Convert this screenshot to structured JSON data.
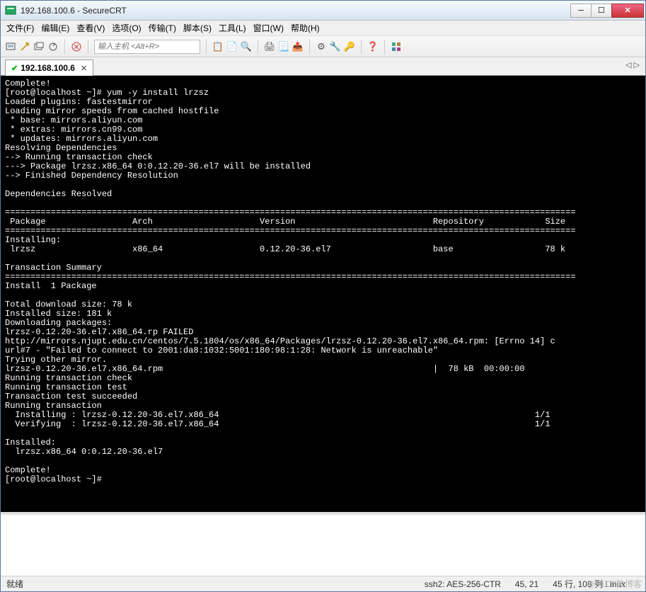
{
  "window": {
    "title": "192.168.100.6 - SecureCRT"
  },
  "menu": {
    "file": "文件(F)",
    "edit": "编辑(E)",
    "view": "查看(V)",
    "options": "选项(O)",
    "transfer": "传输(T)",
    "script": "脚本(S)",
    "tools": "工具(L)",
    "window": "窗口(W)",
    "help": "帮助(H)"
  },
  "toolbar": {
    "host_placeholder": "输入主机 <Alt+R>"
  },
  "tab": {
    "label": "192.168.100.6",
    "close": "✕"
  },
  "terminal": {
    "text": "Complete!\n[root@localhost ~]# yum -y install lrzsz\nLoaded plugins: fastestmirror\nLoading mirror speeds from cached hostfile\n * base: mirrors.aliyun.com\n * extras: mirrors.cn99.com\n * updates: mirrors.aliyun.com\nResolving Dependencies\n--> Running transaction check\n---> Package lrzsz.x86_64 0:0.12.20-36.el7 will be installed\n--> Finished Dependency Resolution\n\nDependencies Resolved\n\n================================================================================================================\n Package                 Arch                     Version                           Repository            Size\n================================================================================================================\nInstalling:\n lrzsz                   x86_64                   0.12.20-36.el7                    base                  78 k\n\nTransaction Summary\n================================================================================================================\nInstall  1 Package\n\nTotal download size: 78 k\nInstalled size: 181 k\nDownloading packages:\nlrzsz-0.12.20-36.el7.x86_64.rp FAILED\nhttp://mirrors.njupt.edu.cn/centos/7.5.1804/os/x86_64/Packages/lrzsz-0.12.20-36.el7.x86_64.rpm: [Errno 14] c\nurl#7 - \"Failed to connect to 2001:da8:1032:5001:180:98:1:28: Network is unreachable\"\nTrying other mirror.\nlrzsz-0.12.20-36.el7.x86_64.rpm                                                     |  78 kB  00:00:00\nRunning transaction check\nRunning transaction test\nTransaction test succeeded\nRunning transaction\n  Installing : lrzsz-0.12.20-36.el7.x86_64                                                              1/1\n  Verifying  : lrzsz-0.12.20-36.el7.x86_64                                                              1/1\n\nInstalled:\n  lrzsz.x86_64 0:0.12.20-36.el7\n\nComplete!\n[root@localhost ~]# "
  },
  "status": {
    "ready": "就绪",
    "ssh": "ssh2: AES-256-CTR",
    "pos": "45,  21",
    "size": "45 行, 108 列 Linux"
  },
  "watermark": "@51CT数博客"
}
